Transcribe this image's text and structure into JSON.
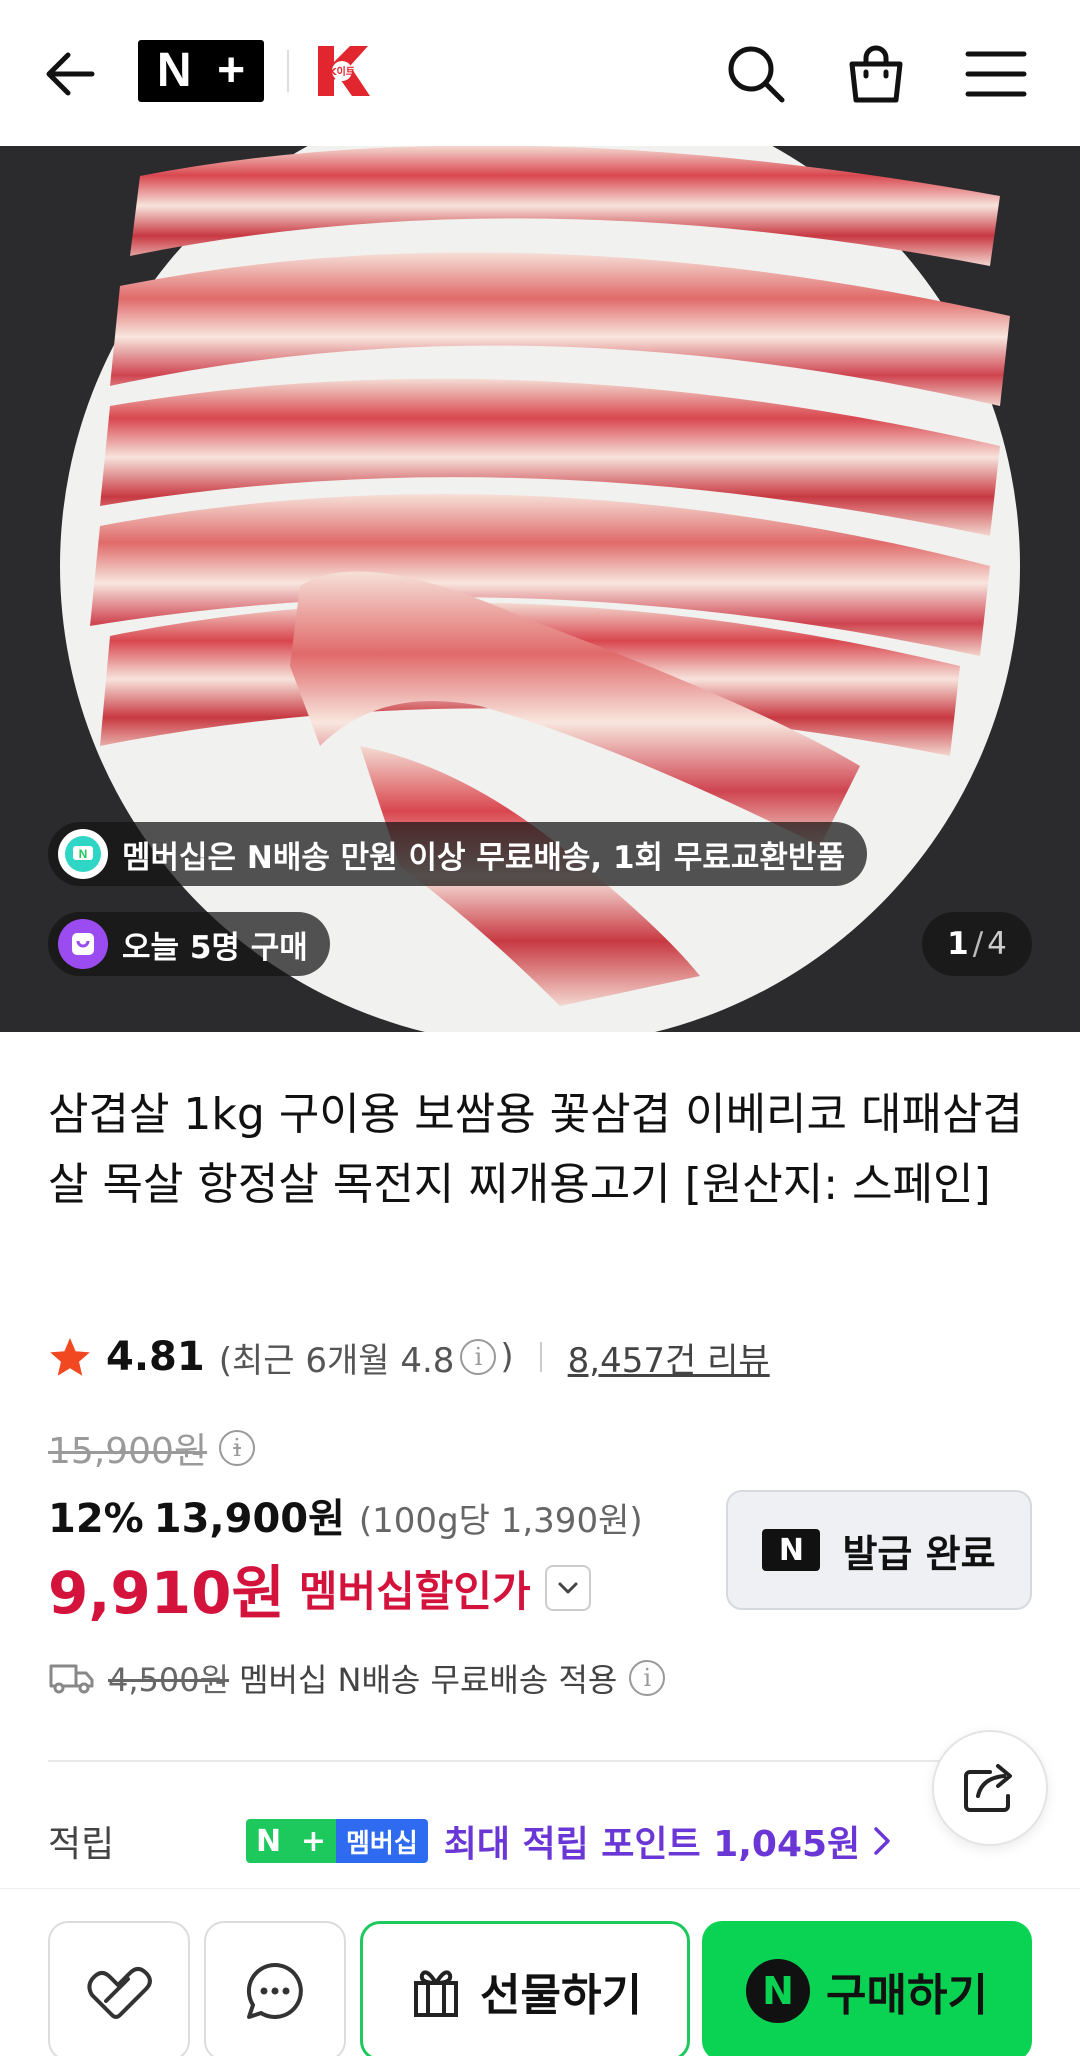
{
  "header": {
    "back_icon": "arrow-left-icon",
    "logo_n": "N",
    "logo_plus": "+",
    "logo_k_text": "K이트",
    "icons": [
      "search-icon",
      "shopping-bag-icon",
      "hamburger-menu-icon"
    ]
  },
  "hero": {
    "membership_chip": "멤버십은 N배송 만원 이상 무료배송, 1회 무료교환반품",
    "membership_chip_icon_text": "N",
    "buyers_chip": "오늘 5명 구매",
    "pager_current": "1",
    "pager_sep": "/",
    "pager_total": "4"
  },
  "product": {
    "title": "삼겹살 1kg 구이용 보쌈용 꽃삼겹 이베리코 대패삼겹살 목살 항정살 목전지 찌개용고기 [원산지: 스페인]",
    "rating": "4.81",
    "rating_recent": "(최근 6개월 4.8",
    "rating_recent_close": ")",
    "reviews": "8,457건 리뷰",
    "original_price": "15,900원",
    "discount_pct": "12%",
    "sale_price": "13,900원",
    "unit_price": "(100g당 1,390원)",
    "member_price": "9,910원",
    "member_label": "멤버십할인가",
    "coupon_badge": "N",
    "coupon_label": "발급 완료",
    "shipping_old": "4,500원",
    "shipping_desc": "멤버십 N배송 무료배송 적용",
    "points_label": "적립",
    "points_badge_n": "N",
    "points_badge_plus": "+",
    "points_badge_member": "멤버십",
    "points_text": "최대 적립 포인트 1,045원"
  },
  "bottom_bar": {
    "gift_label": "선물하기",
    "buy_badge": "N",
    "buy_label": "구매하기"
  },
  "colors": {
    "accent_green": "#0ad353",
    "member_red": "#d3133c",
    "points_purple": "#6a37d6",
    "star": "#f24822"
  }
}
